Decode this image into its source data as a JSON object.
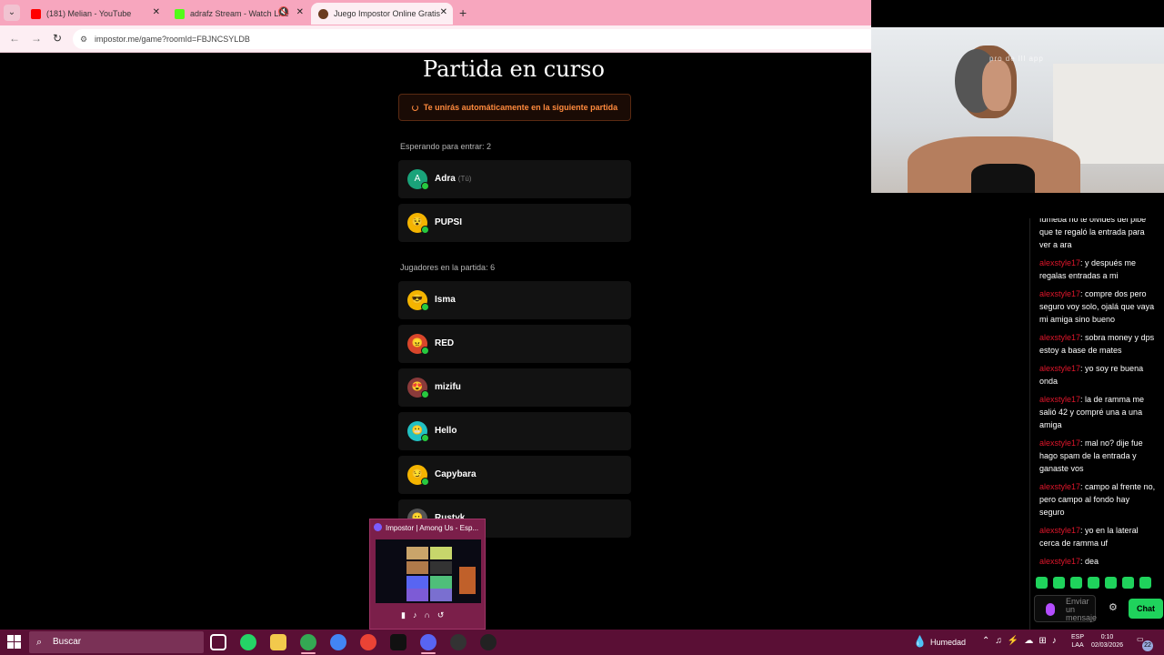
{
  "browser": {
    "tabs": [
      {
        "label": "(181) Melian - YouTube",
        "favicon_color": "#ff0000"
      },
      {
        "label": "adrafz Stream - Watch Live",
        "favicon_color": "#53fc18"
      },
      {
        "label": "Juego Impostor Online Gratis",
        "favicon_color": "#6b3b1f"
      }
    ],
    "new_tab": "+",
    "url": "impostor.me/game?roomId=FBJNCSYLDB"
  },
  "page": {
    "title": "Partida en curso",
    "notice": "Te unirás automáticamente en la siguiente partida",
    "waiting_label": "Esperando para entrar: 2",
    "waiting": [
      {
        "name": "Adra",
        "tag": "(Tú)",
        "avatar": "A",
        "avatar_color": "#1aa37a"
      },
      {
        "name": "PUPSI",
        "tag": "",
        "avatar": "",
        "avatar_color": "#f4b400"
      }
    ],
    "players_label": "Jugadores en la partida: 6",
    "players": [
      {
        "name": "Isma",
        "avatar_color": "#f4b400"
      },
      {
        "name": "RED",
        "avatar_color": "#d9462b"
      },
      {
        "name": "mizifu",
        "avatar_color": "#8a3a3a"
      },
      {
        "name": "Hello",
        "avatar_color": "#22c1c3"
      },
      {
        "name": "Capybara",
        "avatar_color": "#f4b400"
      },
      {
        "name": "Rustyk",
        "avatar_color": "#555555"
      }
    ]
  },
  "webcam": {
    "watermark": "pro de lll app"
  },
  "chat": {
    "messages": [
      {
        "user": "",
        "text": "fumeba no te olvidés del pibe que te regaló la entrada para ver a ara"
      },
      {
        "user": "alexstyle17",
        "text": ": y después me regalas entradas a mi"
      },
      {
        "user": "alexstyle17",
        "text": ": compre dos pero seguro voy solo, ojalá que vaya mi amiga sino bueno"
      },
      {
        "user": "alexstyle17",
        "text": ": sobra money y dps estoy a base de mates"
      },
      {
        "user": "alexstyle17",
        "text": ": yo soy re buena onda"
      },
      {
        "user": "alexstyle17",
        "text": ": la de ramma me salió 42 y compré una a una amiga"
      },
      {
        "user": "alexstyle17",
        "text": ": mal no? dije fue hago spam de la entrada y ganaste vos"
      },
      {
        "user": "alexstyle17",
        "text": ": campo al frente no, pero campo al fondo hay seguro"
      },
      {
        "user": "alexstyle17",
        "text": ": yo en la lateral cerca de ramma uf"
      },
      {
        "user": "alexstyle17",
        "text": ": dea"
      }
    ],
    "placeholder": "Enviar un mensaje",
    "send_label": "Chat"
  },
  "thumbnail": {
    "title": "Impostor | Among Us - Esp..."
  },
  "taskbar": {
    "search": "Buscar",
    "weather": "Humedad",
    "lang_line1": "ESP",
    "lang_line2": "LAA",
    "time": "0:10",
    "date": "02/03/2026",
    "notif_count": "22"
  }
}
